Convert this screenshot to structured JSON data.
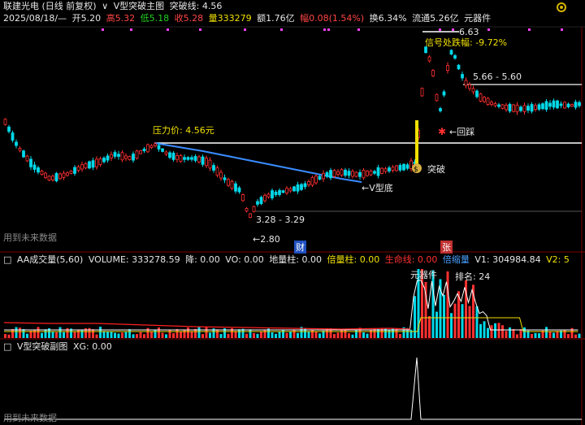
{
  "header": {
    "title": "联建光电 (日线 前复权)",
    "indicator": "V型突破主图",
    "breakout_label": "突破线: 4.56",
    "date": "2025/08/18/—",
    "open": "开5.20",
    "high": "高5.32",
    "low": "低5.18",
    "close": "收5.28",
    "volume": "量333279",
    "amount": "额1.76亿",
    "change": "幅0.08(1.54%)",
    "turnover": "换6.34%",
    "float": "流通5.26亿",
    "sector": "元器件"
  },
  "main": {
    "pressure": "压力价: 4.56元",
    "signal": "信号处跌幅: -9.72%",
    "top_price": "6.63",
    "range_high": "5.66 - 5.60",
    "retrace": "←回踩",
    "breakout": "突破",
    "v_bottom": "←V型底",
    "range_low": "3.28 - 3.29",
    "low_price": "←2.80",
    "future_hint": "用到未来数据",
    "badge_cai": "财",
    "badge_zhang": "张"
  },
  "volume": {
    "title": "AA成交量(5,60)",
    "volume_label": "VOLUME: 333278.59",
    "jiang": "降: 0.00",
    "vo": "VO: 0.00",
    "dilianzhu": "地量柱: 0.00",
    "beiliangzhu": "倍量柱: 0.00",
    "shengming": "生命线: 0.00",
    "beisuoliang": "倍缩量",
    "v1": "V1: 304984.84",
    "v2": "V2: 5",
    "sector_label": "元器件",
    "rank": "排名: 24"
  },
  "sub": {
    "title": "V型突破副图",
    "xg": "XG: 0.00",
    "future_hint": "用到未来数据"
  },
  "colors": {
    "up": "#ff3030",
    "down": "#00d8e8",
    "white_line": "#ffffff",
    "blue_line": "#3a8cff",
    "yellow": "#f0e000"
  }
}
